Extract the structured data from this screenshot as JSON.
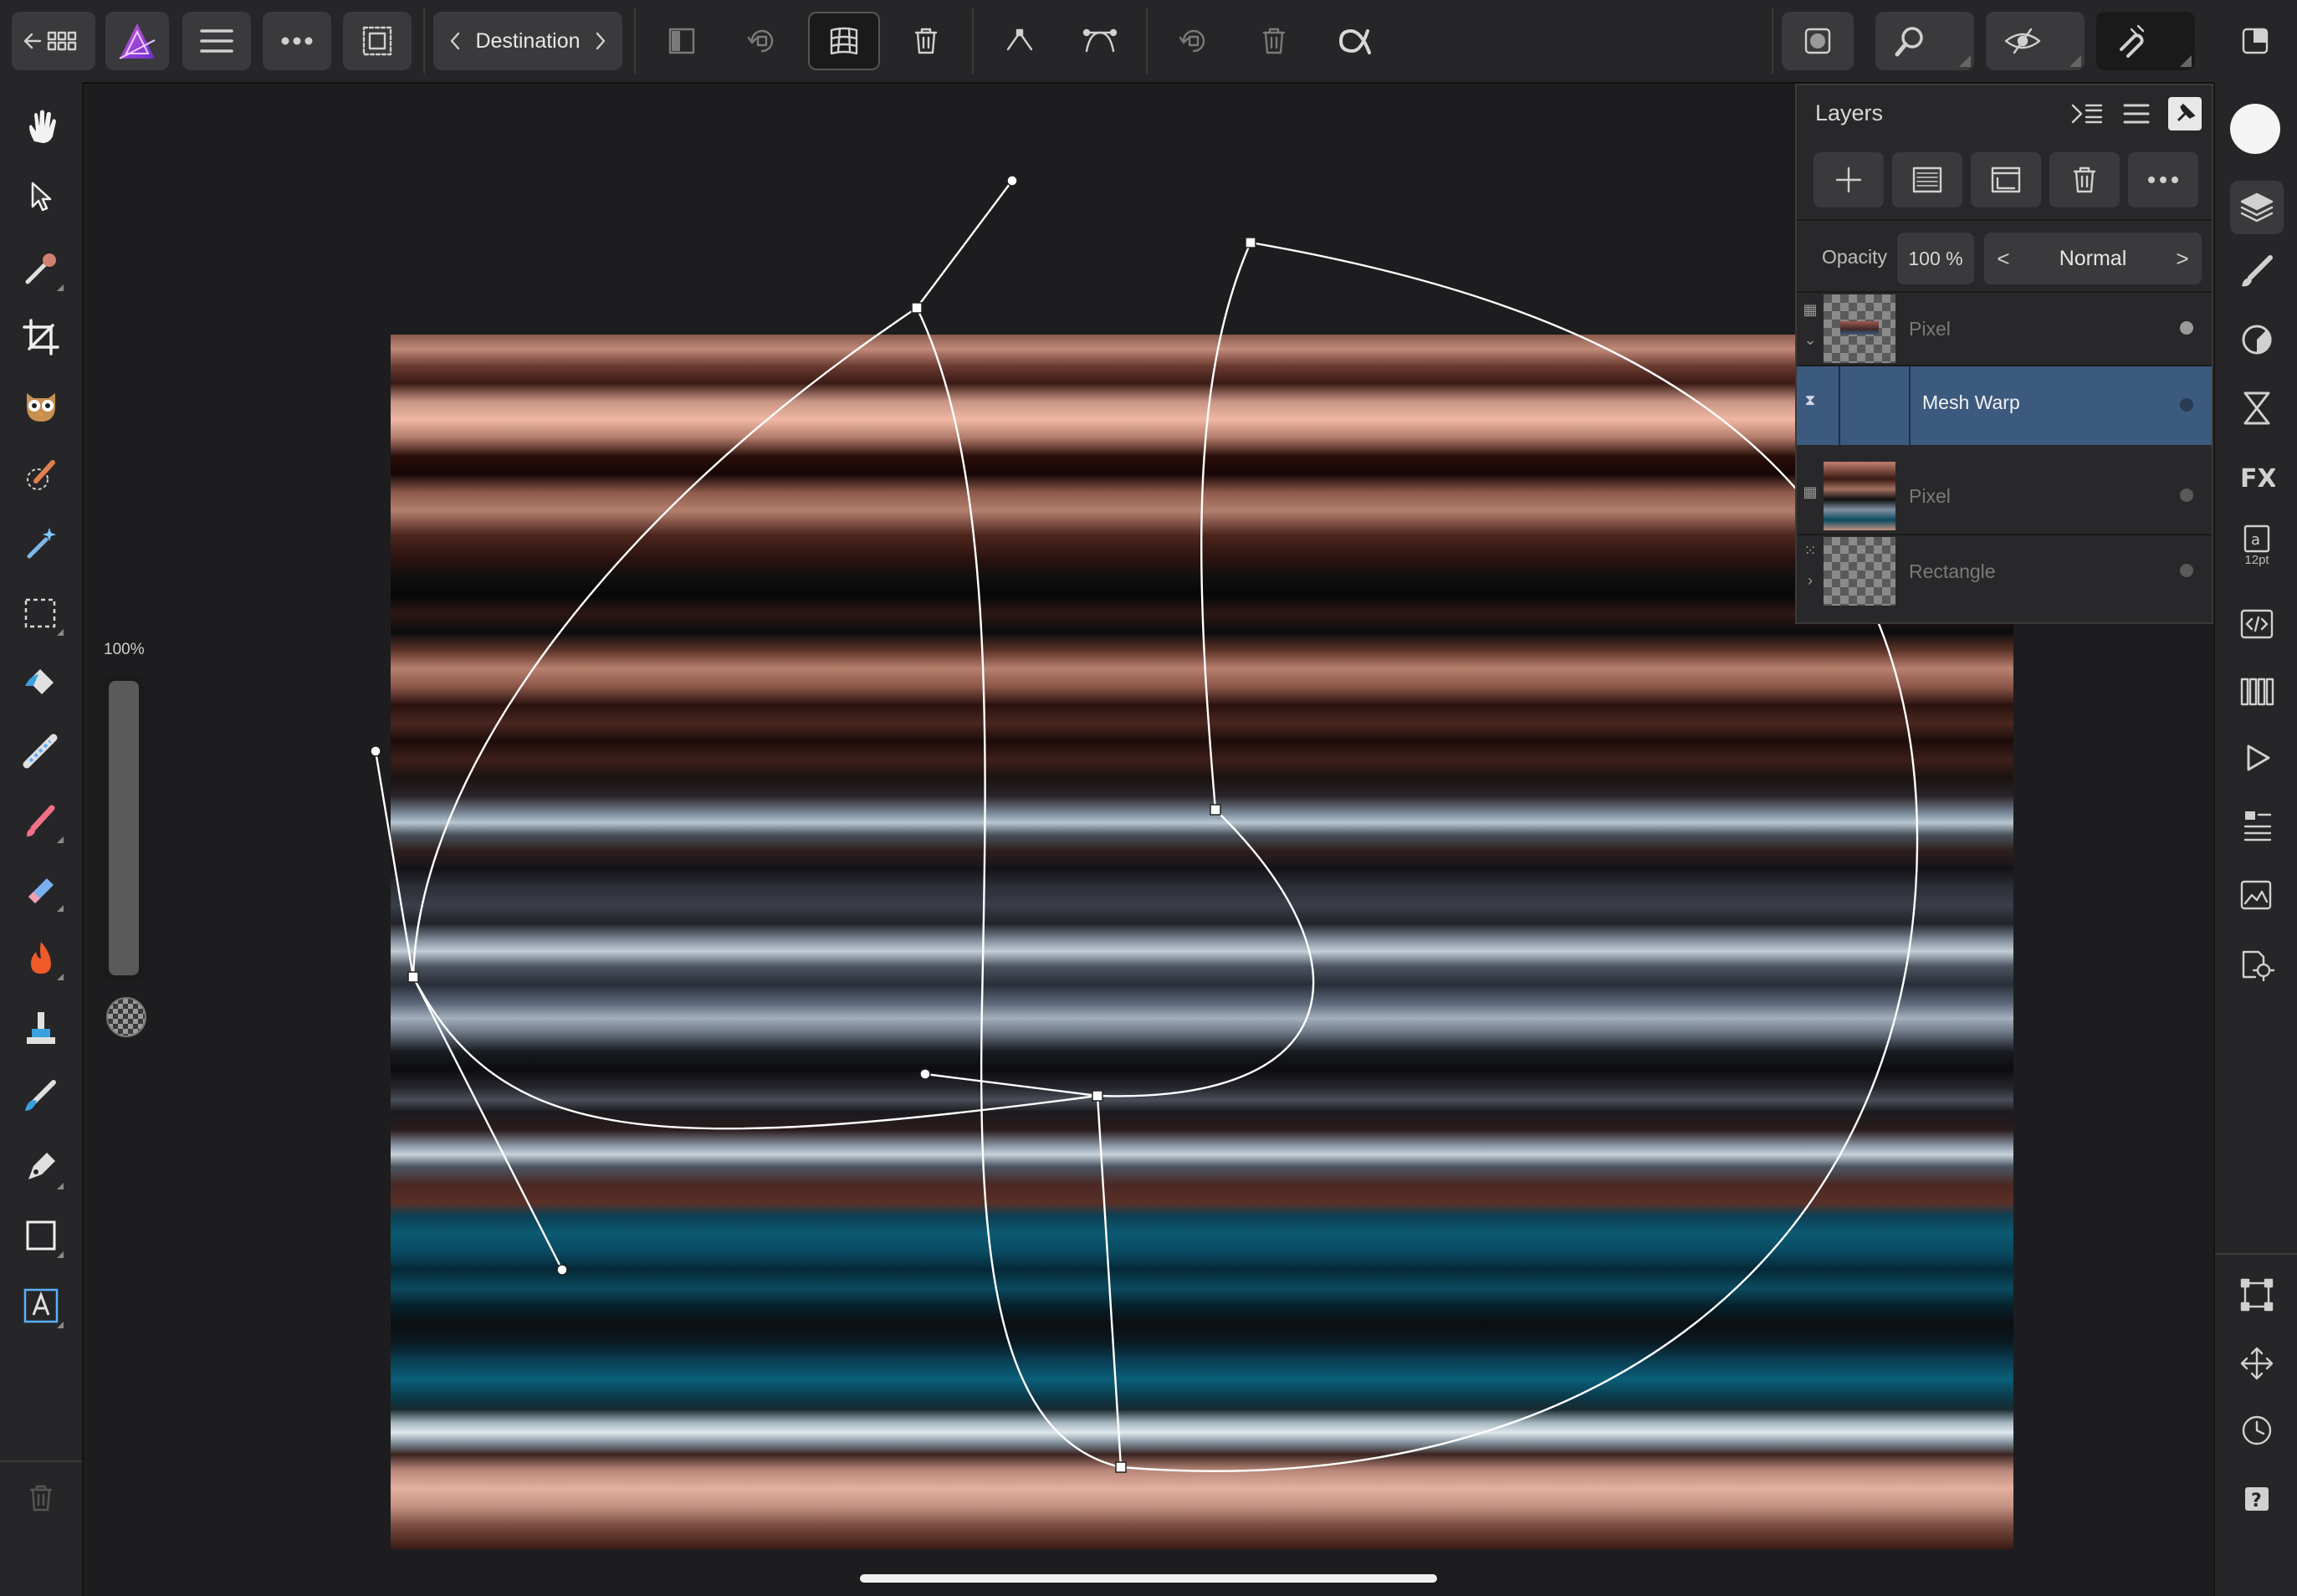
{
  "toolbar": {
    "destination_label": "Destination",
    "icons": [
      "back-grid-icon",
      "app-logo-icon",
      "menu-icon",
      "more-icon",
      "selection-icon",
      "prev-arrow-icon",
      "next-arrow-icon",
      "panel-icon",
      "rotate-icon",
      "mesh-icon",
      "delete-icon",
      "corner-node-icon",
      "smooth-node-icon",
      "reset-icon",
      "trash-icon",
      "alpha-icon",
      "assistant-icon",
      "zoom-icon",
      "view-icon",
      "snapping-icon",
      "fullscreen-icon"
    ]
  },
  "left_tools": [
    "hand-icon",
    "move-icon",
    "color-picker-icon",
    "crop-icon",
    "liquify-icon",
    "selection-brush-icon",
    "magic-wand-icon",
    "marquee-icon",
    "flood-fill-icon",
    "gradient-icon",
    "paint-brush-icon",
    "erase-brush-icon",
    "burn-icon",
    "clone-icon",
    "smudge-icon",
    "pen-icon",
    "rectangle-icon",
    "text-icon",
    "trash-icon"
  ],
  "opacity_slider": {
    "label": "100%",
    "value": 1.0
  },
  "layers_panel": {
    "title": "Layers",
    "opacity_label": "Opacity",
    "opacity_value": "100 %",
    "blend_mode": "Normal",
    "blend_prev": "<",
    "blend_next": ">",
    "layers": [
      {
        "name": "Pixel",
        "selected": false
      },
      {
        "name": "Mesh Warp",
        "selected": true
      },
      {
        "name": "Pixel",
        "selected": false
      },
      {
        "name": "Rectangle",
        "selected": false
      }
    ]
  },
  "studio_strip": {
    "color_well": "#f4f4f4",
    "text_size": "12pt",
    "icons": [
      "layers-icon",
      "brushes-icon",
      "color-icon",
      "adjustments-icon",
      "fx-icon",
      "character-icon",
      "code-icon",
      "swatches-icon",
      "play-icon",
      "navigator-icon",
      "history-icon",
      "settings-icon",
      "transform-icon",
      "move-handles-icon",
      "clock-icon",
      "help-icon"
    ]
  },
  "colors": {
    "selected_layer": "#3c5a7e",
    "toolbar": "#262628",
    "canvas": "#1d1d1f"
  }
}
